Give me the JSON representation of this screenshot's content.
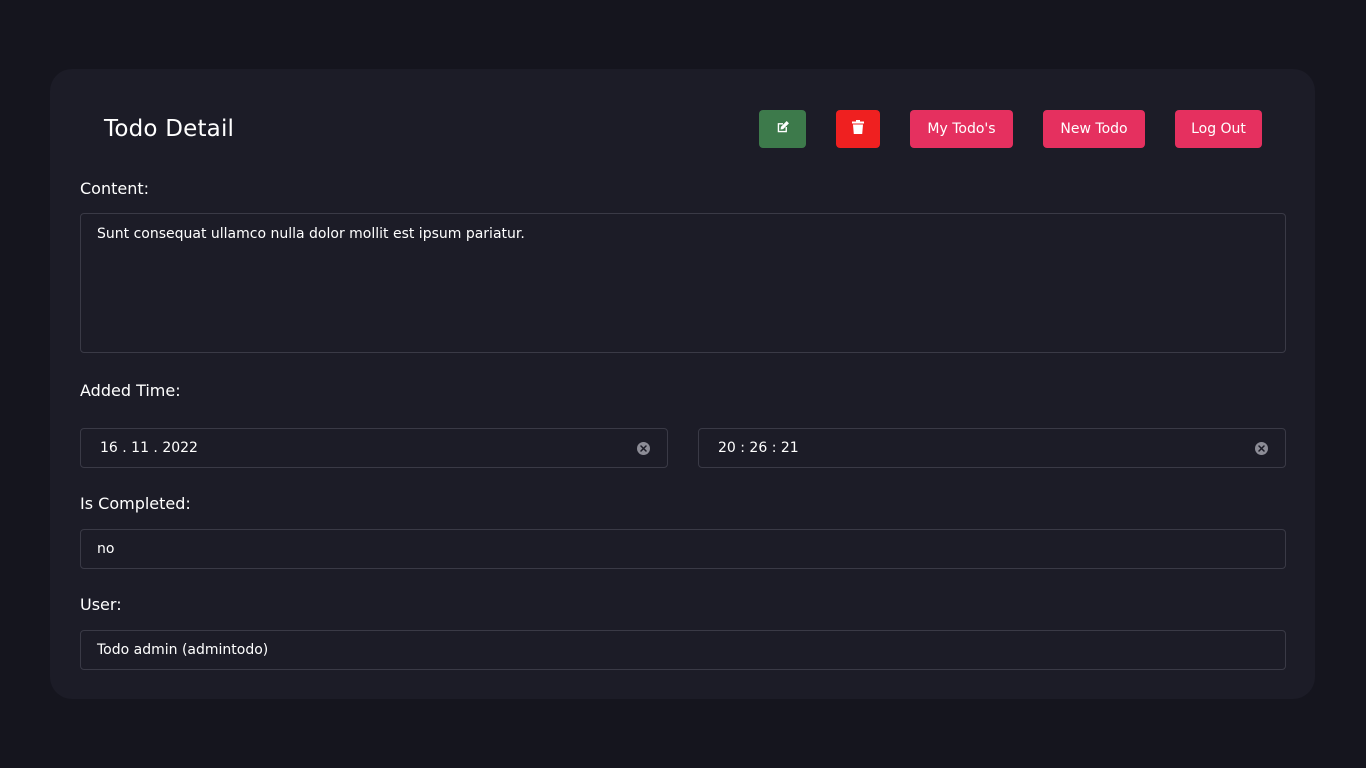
{
  "header": {
    "title": "Todo Detail",
    "my_todos_label": "My Todo's",
    "new_todo_label": "New Todo",
    "logout_label": "Log Out"
  },
  "icons": {
    "edit": "edit-icon",
    "delete": "trash-icon",
    "clear": "clear-circle-icon"
  },
  "form": {
    "content_label": "Content:",
    "content_value": "Sunt consequat ullamco nulla dolor mollit est ipsum pariatur.",
    "added_time_label": "Added Time:",
    "date_value": "16 . 11 . 2022",
    "time_value": "20 : 26 : 21",
    "completed_label": "Is Completed:",
    "completed_value": "no",
    "user_label": "User:",
    "user_value": "Todo admin (admintodo)"
  },
  "colors": {
    "background": "#15151e",
    "card": "#1c1c27",
    "edit_button": "#3d7a4b",
    "delete_button": "#ef2020",
    "accent": "#e5305f"
  }
}
